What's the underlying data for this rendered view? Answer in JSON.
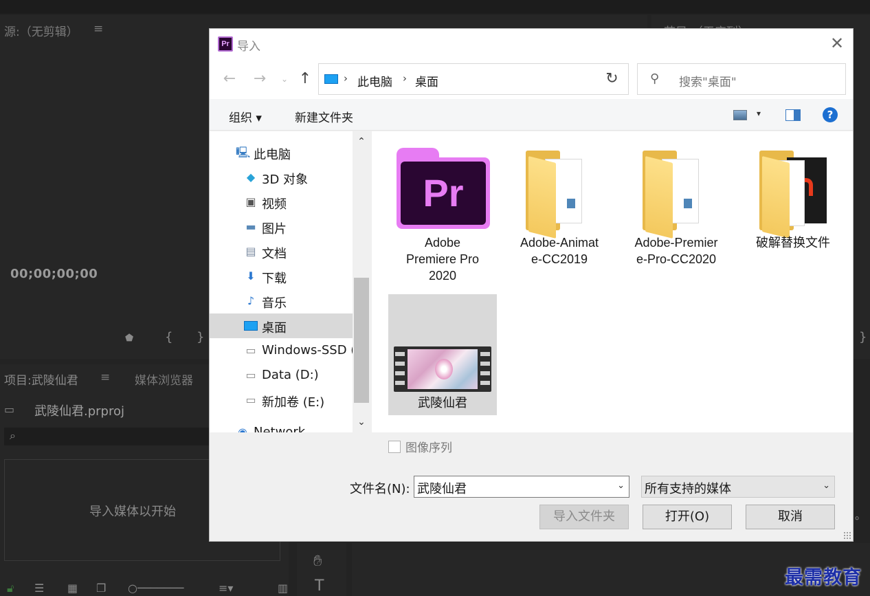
{
  "background_app": {
    "source_panel_title": "源:（无剪辑）",
    "program_panel_title": "节目:（无序列）",
    "timecode": "00;00;00;00",
    "project_tab": "项目:武陵仙君",
    "media_browser_tab": "媒体浏览器",
    "project_file": "武陵仙君.prproj",
    "drop_hint": "导入媒体以开始"
  },
  "dialog": {
    "title": "导入",
    "app_logo_text": "Pr",
    "address": {
      "root": "此电脑",
      "current": "桌面"
    },
    "search_placeholder": "搜索\"桌面\"",
    "toolbar": {
      "organize": "组织 ▾",
      "new_folder": "新建文件夹"
    },
    "nav_items": [
      {
        "label": "此电脑",
        "icon": "computer-icon"
      },
      {
        "label": "3D 对象",
        "icon": "3d-objects-icon"
      },
      {
        "label": "视频",
        "icon": "video-icon"
      },
      {
        "label": "图片",
        "icon": "pictures-icon"
      },
      {
        "label": "文档",
        "icon": "documents-icon"
      },
      {
        "label": "下载",
        "icon": "download-icon"
      },
      {
        "label": "音乐",
        "icon": "music-icon"
      },
      {
        "label": "桌面",
        "icon": "desktop-icon",
        "selected": true
      },
      {
        "label": "Windows-SSD (",
        "icon": "drive-icon"
      },
      {
        "label": "Data (D:)",
        "icon": "drive-icon"
      },
      {
        "label": "新加卷 (E:)",
        "icon": "drive-icon"
      },
      {
        "label": "Network",
        "icon": "network-icon"
      }
    ],
    "files": [
      {
        "label": "Adobe Premiere Pro 2020",
        "label_lines": [
          "Adobe",
          "Premiere Pro",
          "2020"
        ],
        "type": "premiere-app"
      },
      {
        "label": "Adobe-Animate-CC2019",
        "label_lines": [
          "Adobe-Animat",
          "e-CC2019"
        ],
        "type": "folder"
      },
      {
        "label": "Adobe-Premiere-Pro-CC2020",
        "label_lines": [
          "Adobe-Premier",
          "e-Pro-CC2020"
        ],
        "type": "folder"
      },
      {
        "label": "破解替换文件",
        "label_lines": [
          "破解替换文件"
        ],
        "type": "folder-red"
      },
      {
        "label": "武陵仙君",
        "label_lines": [
          "武陵仙君"
        ],
        "type": "video",
        "selected": true
      }
    ],
    "image_sequence_label": "图像序列",
    "filename_label": "文件名(N):",
    "filename_value": "武陵仙君",
    "filter_value": "所有支持的媒体",
    "buttons": {
      "import_folder": "导入文件夹",
      "open": "打开(O)",
      "cancel": "取消"
    }
  },
  "watermark": "最需教育",
  "colors": {
    "premiere_purple": "#2a0632",
    "premiere_accent": "#e77cf3",
    "folder_yellow": "#f4c95e",
    "selection_gray": "#d9d9d9",
    "help_blue": "#1c6fd1"
  }
}
